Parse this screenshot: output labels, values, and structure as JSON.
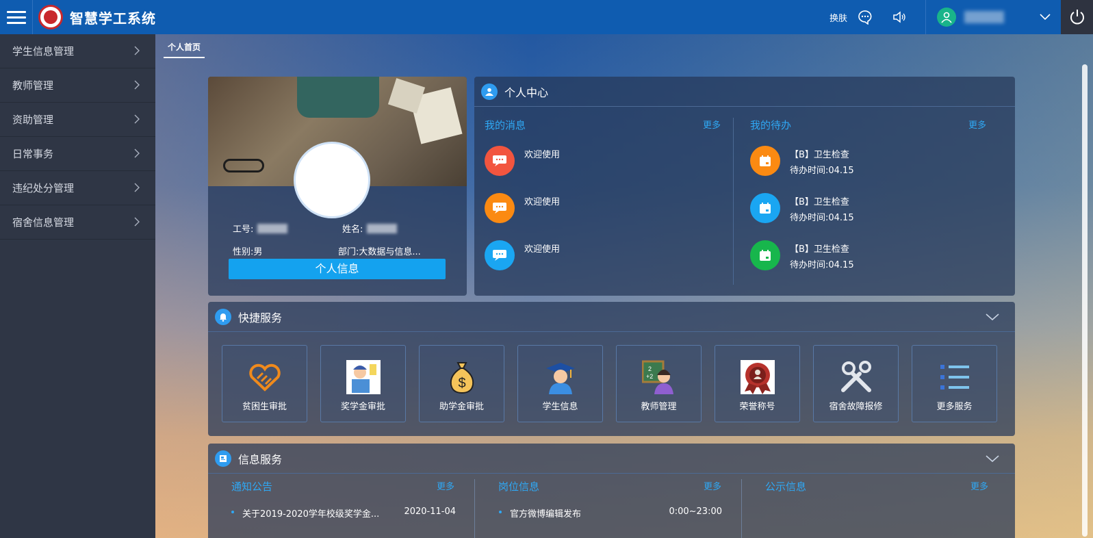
{
  "app": {
    "title": "智慧学工系统"
  },
  "topbar": {
    "skin_label": "换肤"
  },
  "sidebar": {
    "items": [
      {
        "label": "学生信息管理"
      },
      {
        "label": "教师管理"
      },
      {
        "label": "资助管理"
      },
      {
        "label": "日常事务"
      },
      {
        "label": "违纪处分管理"
      },
      {
        "label": "宿舍信息管理"
      }
    ]
  },
  "tabs": [
    {
      "label": "个人首页"
    }
  ],
  "profile": {
    "id_label": "工号:",
    "name_label": "姓名:",
    "gender_label": "性别:",
    "gender_value": "男",
    "dept_label": "部门:",
    "dept_value": "大数据与信息...",
    "button_label": "个人信息"
  },
  "personal_center": {
    "title": "个人中心",
    "messages": {
      "title": "我的消息",
      "more": "更多",
      "items": [
        {
          "text": "欢迎使用",
          "color": "#f2553f"
        },
        {
          "text": "欢迎使用",
          "color": "#fb8a12"
        },
        {
          "text": "欢迎使用",
          "color": "#1aa6f2"
        }
      ]
    },
    "todos": {
      "title": "我的待办",
      "more": "更多",
      "items": [
        {
          "title": "【B】卫生检查",
          "time": "待办时间:04.15",
          "color": "#fb8a12"
        },
        {
          "title": "【B】卫生检查",
          "time": "待办时间:04.15",
          "color": "#1aa6f2"
        },
        {
          "title": "【B】卫生检查",
          "time": "待办时间:04.15",
          "color": "#17b64c"
        }
      ]
    }
  },
  "quick_services": {
    "title": "快捷服务",
    "items": [
      {
        "label": "贫困生审批"
      },
      {
        "label": "奖学金审批"
      },
      {
        "label": "助学金审批"
      },
      {
        "label": "学生信息"
      },
      {
        "label": "教师管理"
      },
      {
        "label": "荣誉称号"
      },
      {
        "label": "宿舍故障报修"
      },
      {
        "label": "更多服务"
      }
    ]
  },
  "info_services": {
    "title": "信息服务",
    "notices": {
      "title": "通知公告",
      "more": "更多",
      "first_item": "关于2019-2020学年校级奖学金...",
      "first_date": "2020-11-04"
    },
    "jobs": {
      "title": "岗位信息",
      "more": "更多",
      "first_item": "官方微博编辑发布",
      "first_time": "0:00~23:00"
    },
    "public": {
      "title": "公示信息",
      "more": "更多"
    }
  }
}
